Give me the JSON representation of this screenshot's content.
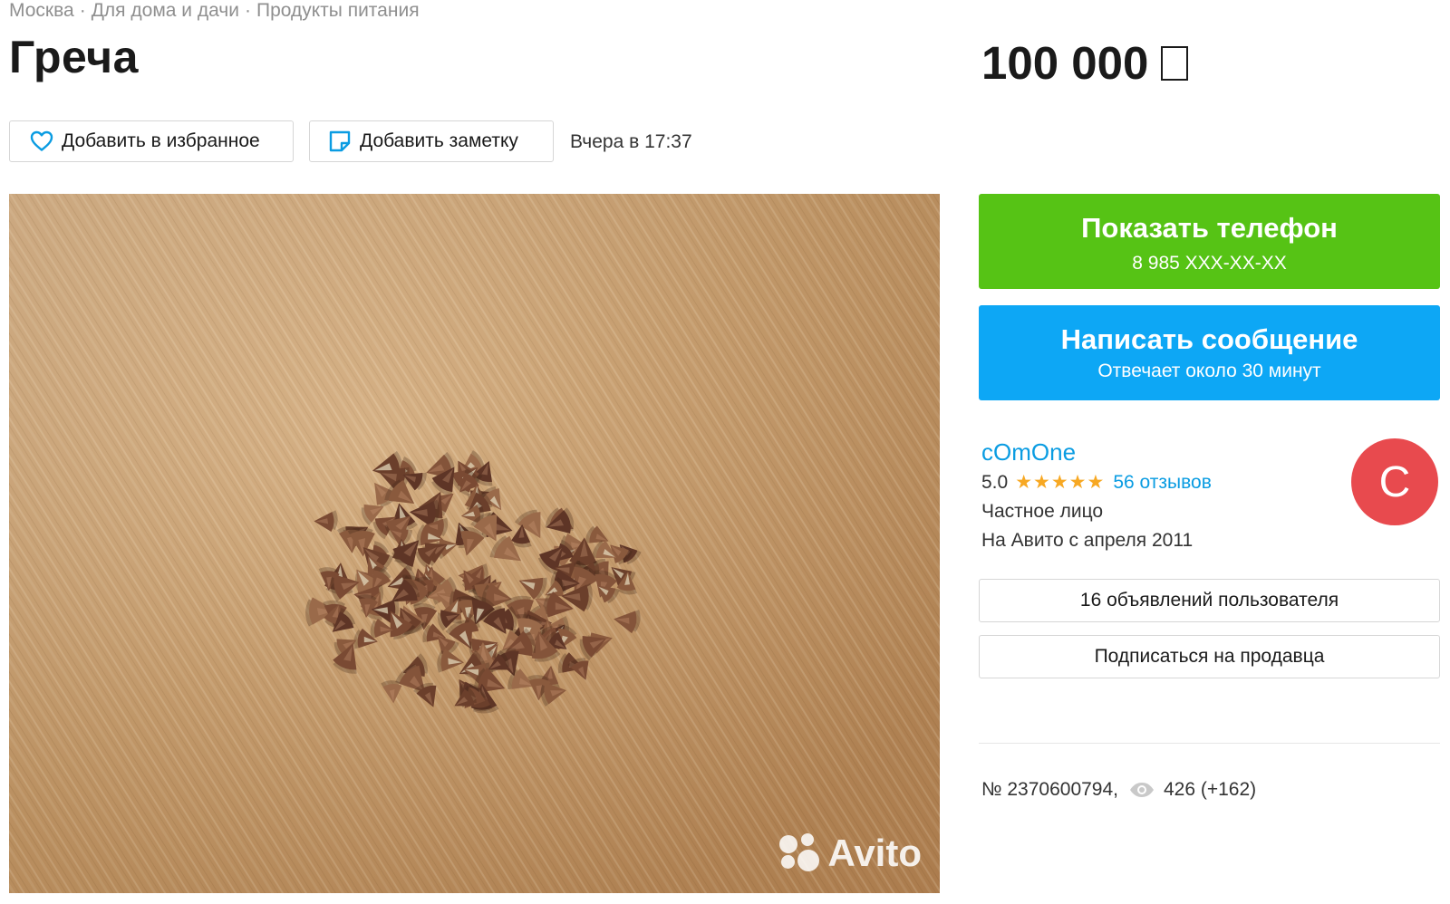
{
  "breadcrumbs": [
    "Москва",
    "Для дома и дачи",
    "Продукты питания"
  ],
  "breadcrumb_separator": "·",
  "title": "Греча",
  "price": "100 000",
  "actions": {
    "favorite_label": "Добавить в избранное",
    "note_label": "Добавить заметку",
    "posted": "Вчера в 17:37"
  },
  "photo": {
    "watermark": "Avito"
  },
  "contact": {
    "phone_title": "Показать телефон",
    "phone_number": "8 985 XXX-XX-XX",
    "message_title": "Написать сообщение",
    "message_sub": "Отвечает около 30 минут"
  },
  "seller": {
    "name": "cOmOne",
    "rating": "5.0",
    "stars": "★★★★★",
    "reviews": "56 отзывов",
    "type": "Частное лицо",
    "since": "На Авито с апреля 2011",
    "avatar_letter": "C",
    "listings_label": "16 объявлений пользователя",
    "subscribe_label": "Подписаться на продавца"
  },
  "meta": {
    "ad_number": "№ 2370600794,",
    "views": "426 (+162)"
  },
  "colors": {
    "green": "#56c315",
    "blue": "#0da7f5",
    "link": "#0a9ce2",
    "star": "#f7a823",
    "avatar": "#e84a4e"
  }
}
